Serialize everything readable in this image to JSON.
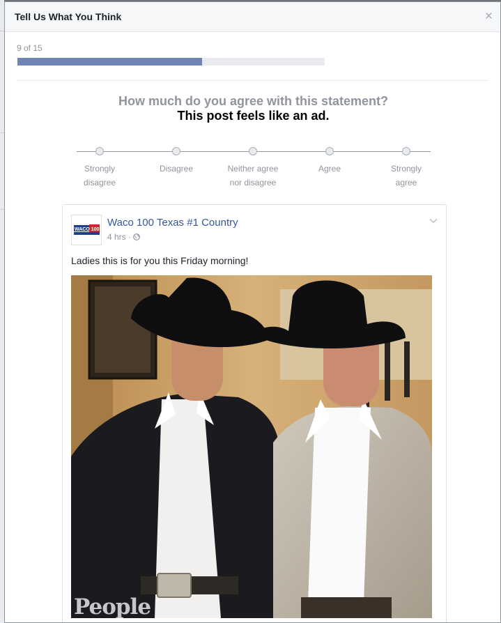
{
  "dialog": {
    "title": "Tell Us What You Think",
    "close_label": "×"
  },
  "progress": {
    "text": "9 of 15",
    "current": 9,
    "total": 15,
    "fill_color": "#6d84b4"
  },
  "question": {
    "prompt": "How much do you agree with this statement?",
    "statement": "This post feels like an ad."
  },
  "scale": {
    "options": [
      {
        "label": "Strongly\ndisagree"
      },
      {
        "label": "Disagree"
      },
      {
        "label": "Neither agree\nnor disagree"
      },
      {
        "label": "Agree"
      },
      {
        "label": "Strongly\nagree"
      }
    ]
  },
  "post": {
    "page_name": "Waco 100 Texas #1 Country",
    "timestamp": "4 hrs",
    "privacy_icon": "globe-icon",
    "avatar_logo_text": "WACO 100",
    "text": "Ladies this is for you this Friday morning!",
    "photo_watermark": "People"
  },
  "colors": {
    "link": "#365899",
    "muted": "#90949c",
    "accent": "#6d84b4"
  }
}
